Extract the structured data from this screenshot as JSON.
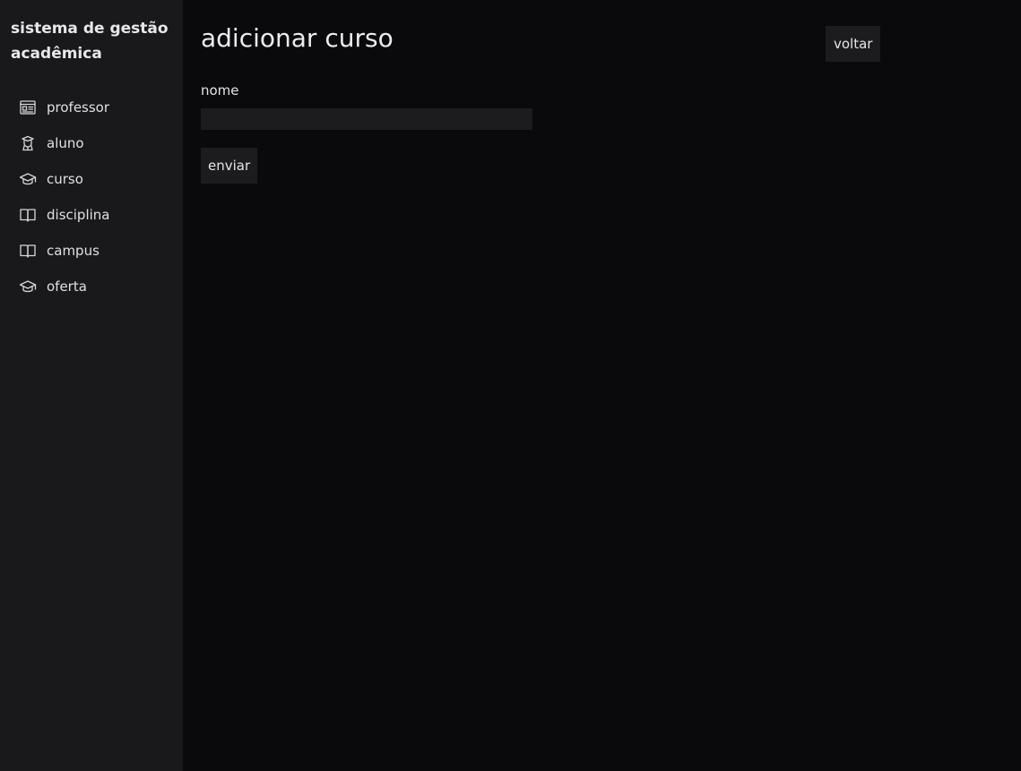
{
  "app": {
    "brand": "sistema de gestão acadêmica"
  },
  "sidebar": {
    "items": [
      {
        "label": "professor",
        "icon": "id-card-icon"
      },
      {
        "label": "aluno",
        "icon": "student-icon"
      },
      {
        "label": "curso",
        "icon": "graduation-cap-icon"
      },
      {
        "label": "disciplina",
        "icon": "book-icon"
      },
      {
        "label": "campus",
        "icon": "book-icon"
      },
      {
        "label": "oferta",
        "icon": "graduation-cap-icon"
      }
    ]
  },
  "main": {
    "title": "adicionar curso",
    "back_label": "voltar",
    "form": {
      "name_label": "nome",
      "name_value": "",
      "name_placeholder": "",
      "submit_label": "enviar"
    }
  },
  "colors": {
    "background": "#0a0a0c",
    "sidebar": "#19191b",
    "control": "#1c1c1f",
    "text": "#e4e4e6"
  }
}
